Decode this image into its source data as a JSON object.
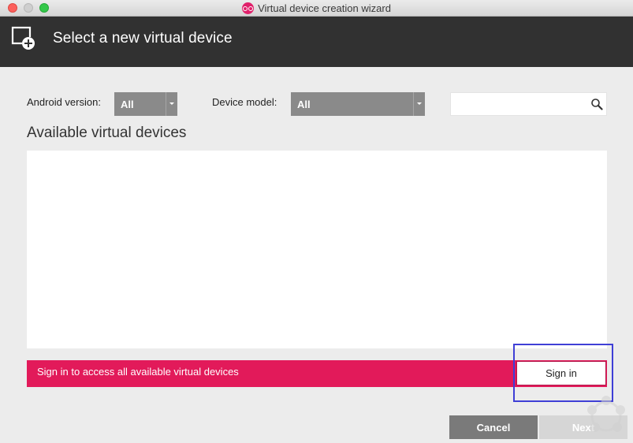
{
  "window": {
    "title": "Virtual device creation wizard"
  },
  "header": {
    "title": "Select a new virtual device",
    "icon": "new-device-icon"
  },
  "filters": {
    "android_version_label": "Android version:",
    "android_version_value": "All",
    "device_model_label": "Device model:",
    "device_model_value": "All",
    "search_placeholder": "",
    "search_value": ""
  },
  "devices": {
    "title": "Available virtual devices",
    "items": []
  },
  "signin": {
    "message": "Sign in to access all available virtual devices",
    "button_label": "Sign in"
  },
  "footer": {
    "cancel_label": "Cancel",
    "next_label": "Next"
  },
  "colors": {
    "accent": "#e21a5a",
    "header_bg": "#313131",
    "highlight": "#3f3fd6"
  }
}
